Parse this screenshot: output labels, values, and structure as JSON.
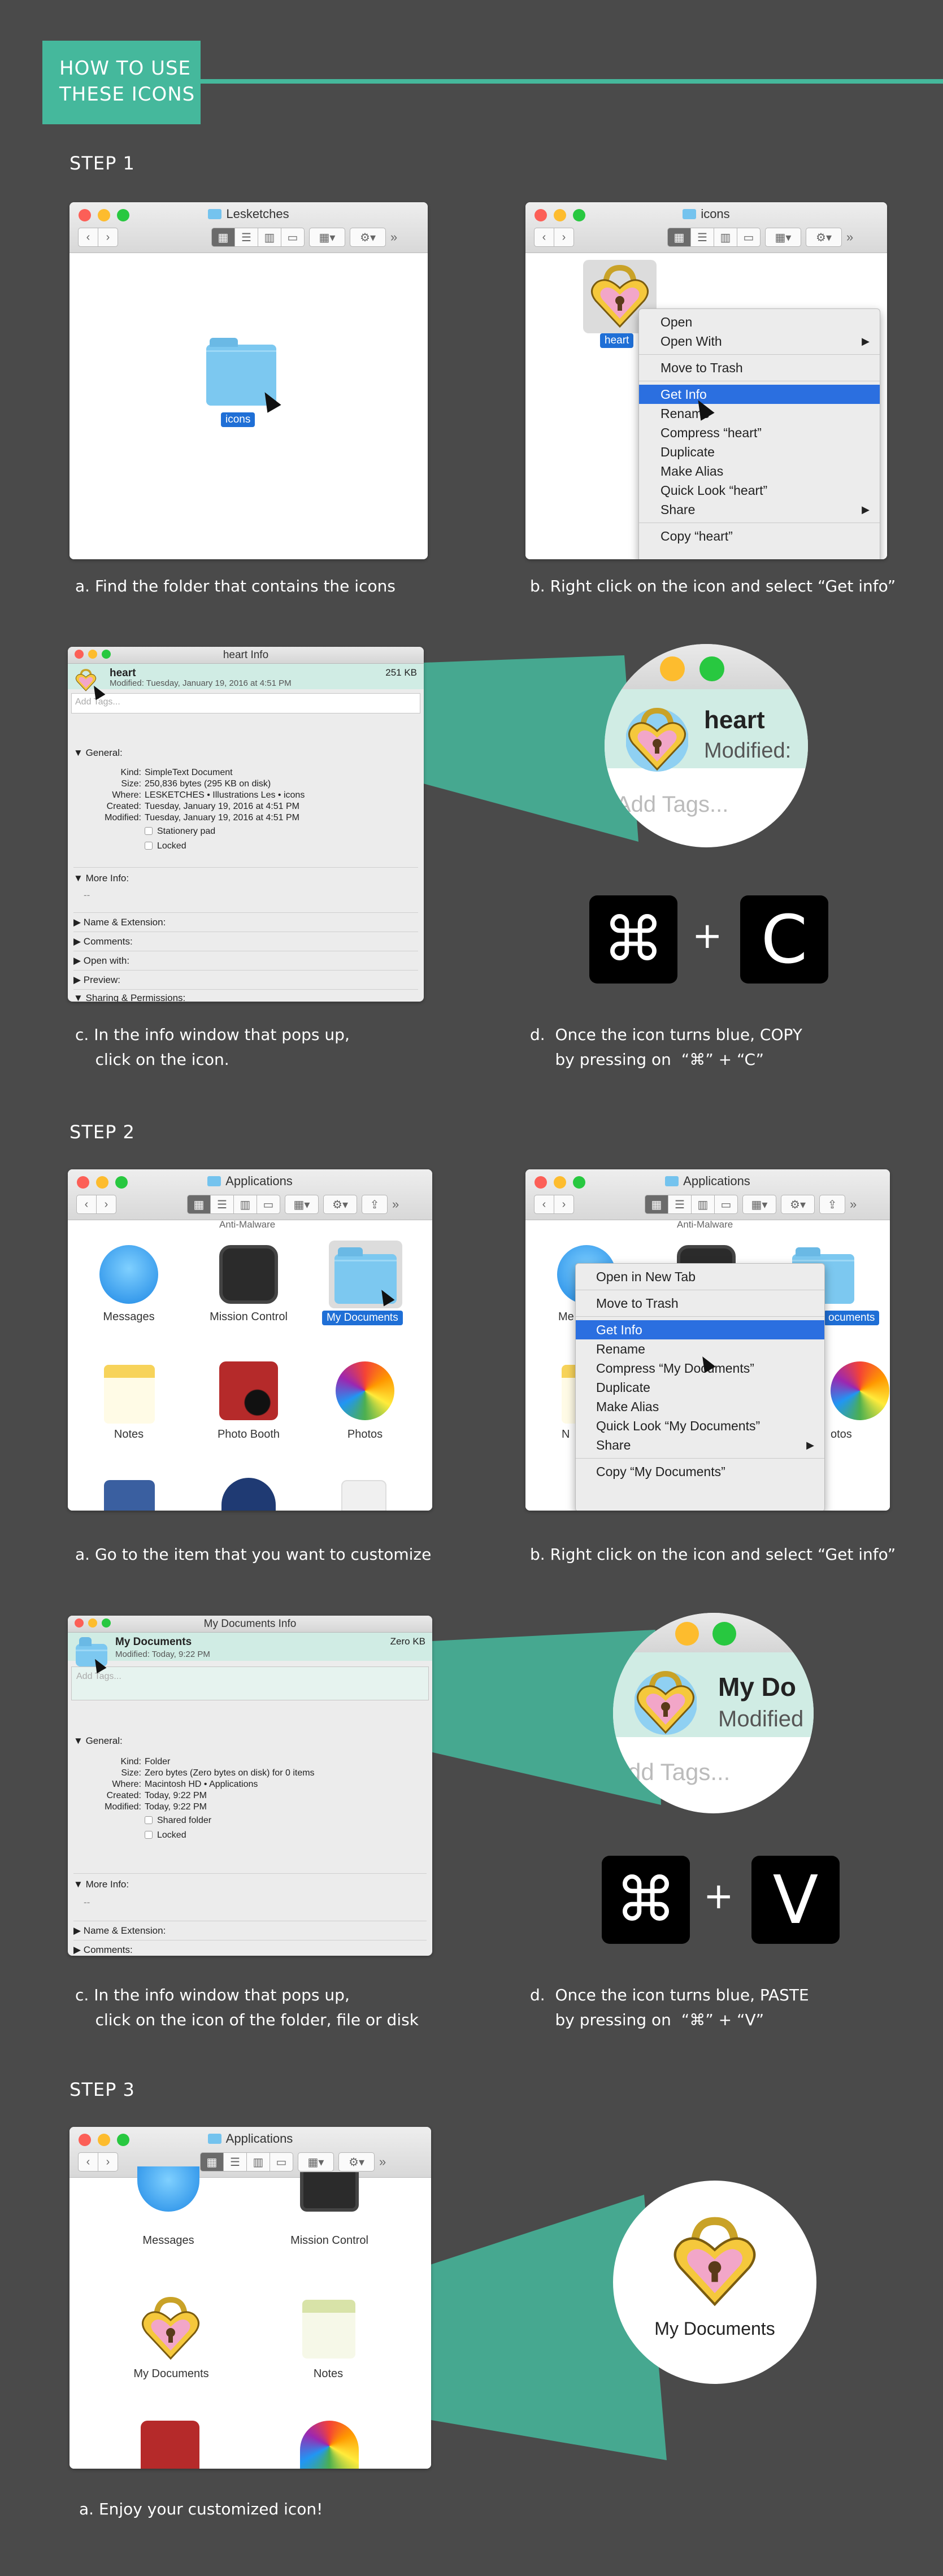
{
  "header": {
    "title_line1": "HOW TO USE",
    "title_line2": "THESE ICONS"
  },
  "colors": {
    "accent": "#45b89c",
    "background": "#4a4a4a",
    "selection": "#1f6fd6"
  },
  "steps": {
    "step1": {
      "label": "STEP 1",
      "win_a": {
        "title": "Lesketches",
        "folder_label": "icons"
      },
      "win_b": {
        "title": "icons",
        "file_label": "heart",
        "menu": [
          "Open",
          "Open With",
          "Move to Trash",
          "Get Info",
          "Rename",
          "Compress “heart”",
          "Duplicate",
          "Make Alias",
          "Quick Look “heart”",
          "Share",
          "Copy “heart”"
        ]
      },
      "cap_a": "a. Find the folder that contains the icons",
      "cap_b": "b. Right click on the icon and select “Get info”",
      "info": {
        "title": "heart Info",
        "name": "heart",
        "size": "251 KB",
        "modified": "Modified: Tuesday, January 19, 2016 at 4:51 PM",
        "tags_placeholder": "Add Tags...",
        "general": "General:",
        "kind": "SimpleText Document",
        "size_full": "250,836 bytes (295 KB on disk)",
        "where": "LESKETCHES • Illustrations Les • icons",
        "created": "Tuesday, January 19, 2016 at 4:51 PM",
        "modified_full": "Tuesday, January 19, 2016 at 4:51 PM",
        "stationery": "Stationery pad",
        "locked": "Locked",
        "more_info": "More Info:",
        "dashes": "--",
        "sections": [
          "Name & Extension:",
          "Comments:",
          "Open with:",
          "Preview:",
          "Sharing & Permissions:"
        ],
        "k_kind": "Kind:",
        "k_size": "Size:",
        "k_where": "Where:",
        "k_created": "Created:",
        "k_modified": "Modified:"
      },
      "zoom": {
        "name": "heart",
        "modified": "Modified:",
        "tags": "Add Tags..."
      },
      "keys": {
        "cmd": "⌘",
        "plus": "+",
        "letter": "C"
      },
      "cap_c": "c. In the info window that pops up,\n    click on the icon.",
      "cap_d": "d.  Once the icon turns blue, COPY\n     by pressing on  “⌘” + “C”"
    },
    "step2": {
      "label": "STEP 2",
      "win_a": {
        "title": "Applications",
        "partial": "Anti-Malware",
        "apps": [
          "Messages",
          "Mission Control",
          "My Documents",
          "Notes",
          "Photo Booth",
          "Photos"
        ]
      },
      "win_b": {
        "title": "Applications",
        "partial": "Anti-Malware",
        "sel_label": "ocuments",
        "menu": [
          "Open in New Tab",
          "Move to Trash",
          "Get Info",
          "Rename",
          "Compress “My Documents”",
          "Duplicate",
          "Make Alias",
          "Quick Look “My Documents”",
          "Share",
          "Copy “My Documents”"
        ],
        "side_left": "Me",
        "side_n": "N",
        "side_otos": "otos"
      },
      "cap_a": "a. Go to the item that you want to customize",
      "cap_b": "b. Right click on the icon and select “Get info”",
      "info": {
        "title": "My Documents Info",
        "name": "My Documents",
        "size": "Zero KB",
        "modified": "Modified: Today, 9:22 PM",
        "tags_placeholder": "Add Tags...",
        "general": "General:",
        "kind": "Folder",
        "size_full": "Zero bytes (Zero bytes on disk) for 0 items",
        "where": "Macintosh HD • Applications",
        "created": "Today, 9:22 PM",
        "modified_full": "Today, 9:22 PM",
        "shared": "Shared folder",
        "locked": "Locked",
        "more_info": "More Info:",
        "dashes": "--",
        "sections": [
          "Name & Extension:",
          "Comments:"
        ],
        "k_kind": "Kind:",
        "k_size": "Size:",
        "k_where": "Where:",
        "k_created": "Created:",
        "k_modified": "Modified:"
      },
      "zoom": {
        "name": "My Do",
        "modified": "Modified",
        "tags": "dd Tags..."
      },
      "keys": {
        "cmd": "⌘",
        "plus": "+",
        "letter": "V"
      },
      "cap_c": "c. In the info window that pops up,\n    click on the icon of the folder, file or disk",
      "cap_d": "d.  Once the icon turns blue, PASTE\n     by pressing on  “⌘” + “V”"
    },
    "step3": {
      "label": "STEP 3",
      "win": {
        "title": "Applications",
        "apps": [
          "Messages",
          "Mission Control",
          "My Documents",
          "Notes"
        ]
      },
      "zoom_label": "My Documents",
      "cap_a": "a. Enjoy your customized icon!"
    }
  }
}
